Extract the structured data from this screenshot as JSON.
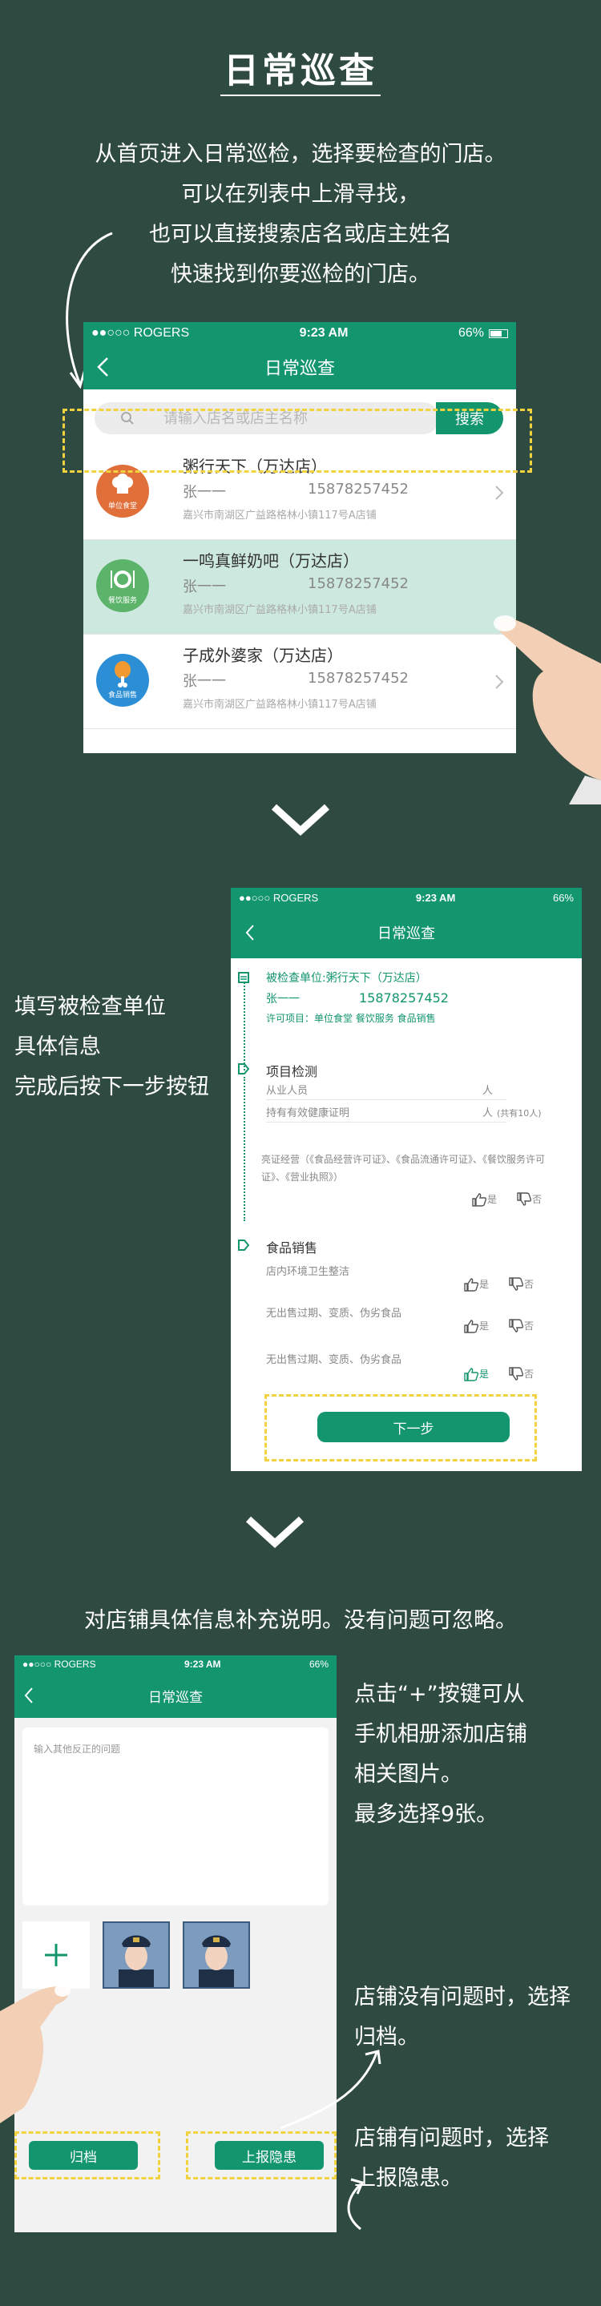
{
  "header": {
    "title": "日常巡查",
    "intro": [
      "从首页进入日常巡检，选择要检查的门店。",
      "可以在列表中上滑寻找，",
      "也可以直接搜索店名或店主姓名",
      "快速找到你要巡检的门店。"
    ]
  },
  "status": {
    "carrier": "●●○○○ ROGERS",
    "time": "9:23 AM",
    "battery": "66%"
  },
  "nav": {
    "title": "日常巡查"
  },
  "screen1": {
    "search_placeholder": "请输入店名或店主名称",
    "search_button": "搜索",
    "stores": [
      {
        "name": "粥行天下（万达店）",
        "owner": "张一一",
        "phone": "15878257452",
        "address": "嘉兴市南湖区广益路格林小镇117号A店铺",
        "badge": "单位食堂",
        "color": "#e06f3a"
      },
      {
        "name": "一鸣真鲜奶吧（万达店）",
        "owner": "张一一",
        "phone": "15878257452",
        "address": "嘉兴市南湖区广益路格林小镇117号A店铺",
        "badge": "餐饮服务",
        "color": "#5cb36a"
      },
      {
        "name": "子成外婆家（万达店）",
        "owner": "张一一",
        "phone": "15878257452",
        "address": "嘉兴市南湖区广益路格林小镇117号A店铺",
        "badge": "食品销售",
        "color": "#2c8fd6"
      }
    ]
  },
  "step2": {
    "instructions": [
      "填写被检查单位",
      "具体信息",
      "完成后按下一步按钮"
    ],
    "unit_label": "被检查单位:粥行天下（万达店）",
    "owner": "张一一",
    "phone": "15878257452",
    "license": "许可项目：单位食堂  餐饮服务  食品销售",
    "section1": "项目检测",
    "staff_label": "从业人员",
    "staff_unit": "人",
    "health_label": "持有有效健康证明",
    "health_unit": "人",
    "health_note": "(共有10人)",
    "license_text": "亮证经营（《食品经营许可证》、《食品流通许可证》、《餐饮服务许可证》、《营业执照》）",
    "yes": "是",
    "no": "否",
    "section2": "食品销售",
    "item1": "店内环境卫生整洁",
    "item2": "无出售过期、变质、伪劣食品",
    "item3": "无出售过期、变质、伪劣食品",
    "next_button": "下一步"
  },
  "step3": {
    "intro": "对店铺具体信息补充说明。没有问题可忽略。",
    "textarea_placeholder": "输入其他反正的问题",
    "add_hint": [
      "点击“+”按键可从",
      "手机相册添加店铺",
      "相关图片。",
      "最多选择9张。"
    ],
    "archive_hint": [
      "店铺没有问题时，选择",
      "归档。"
    ],
    "report_hint": [
      "店铺有问题时，选择",
      "上报隐患。"
    ],
    "archive_button": "归档",
    "report_button": "上报隐患"
  },
  "colors": {
    "background": "#2f4a40",
    "accent": "#13956e",
    "highlight": "#f2d23f"
  }
}
